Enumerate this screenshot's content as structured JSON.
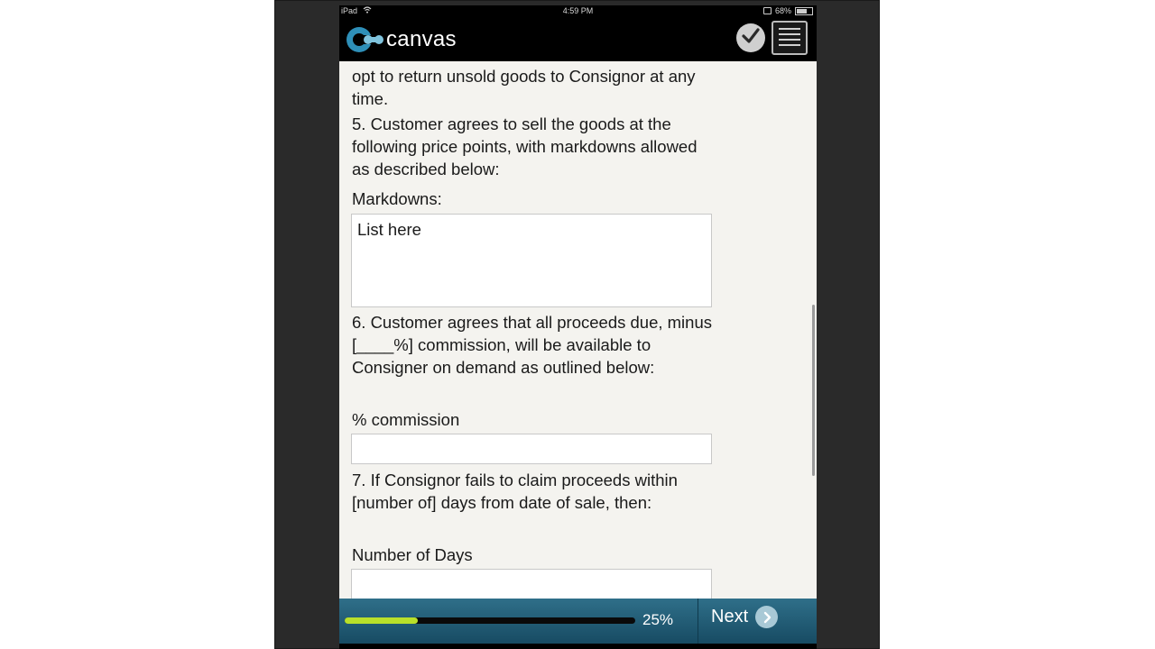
{
  "status_bar": {
    "device": "iPad",
    "time": "4:59 PM",
    "battery": "68%",
    "battery_level": 0.68
  },
  "app_bar": {
    "logo_text": "canvas"
  },
  "form": {
    "para_top": "opt to return unsold goods to Consignor at any time.",
    "para_5": "5. Customer agrees to sell the goods at the following price points, with markdowns allowed as described below:",
    "markdowns_label": "Markdowns:",
    "markdowns_value": "List here",
    "para_6": "6. Customer agrees that all proceeds due, minus [____%] commission, will be available to Consigner on demand as outlined below:",
    "commission_label": "% commission",
    "commission_value": "",
    "para_7": "7. If Consignor fails to claim proceeds within [number of] days from date of sale, then:",
    "days_label": "Number of Days",
    "days_value": ""
  },
  "footer": {
    "progress_percent": 25,
    "progress_label": "25%",
    "next_label": "Next"
  },
  "colors": {
    "progress_fill": "#b9e02a",
    "footer_bar": "#2f6f89",
    "logo_accent": "#2e8fb8"
  }
}
